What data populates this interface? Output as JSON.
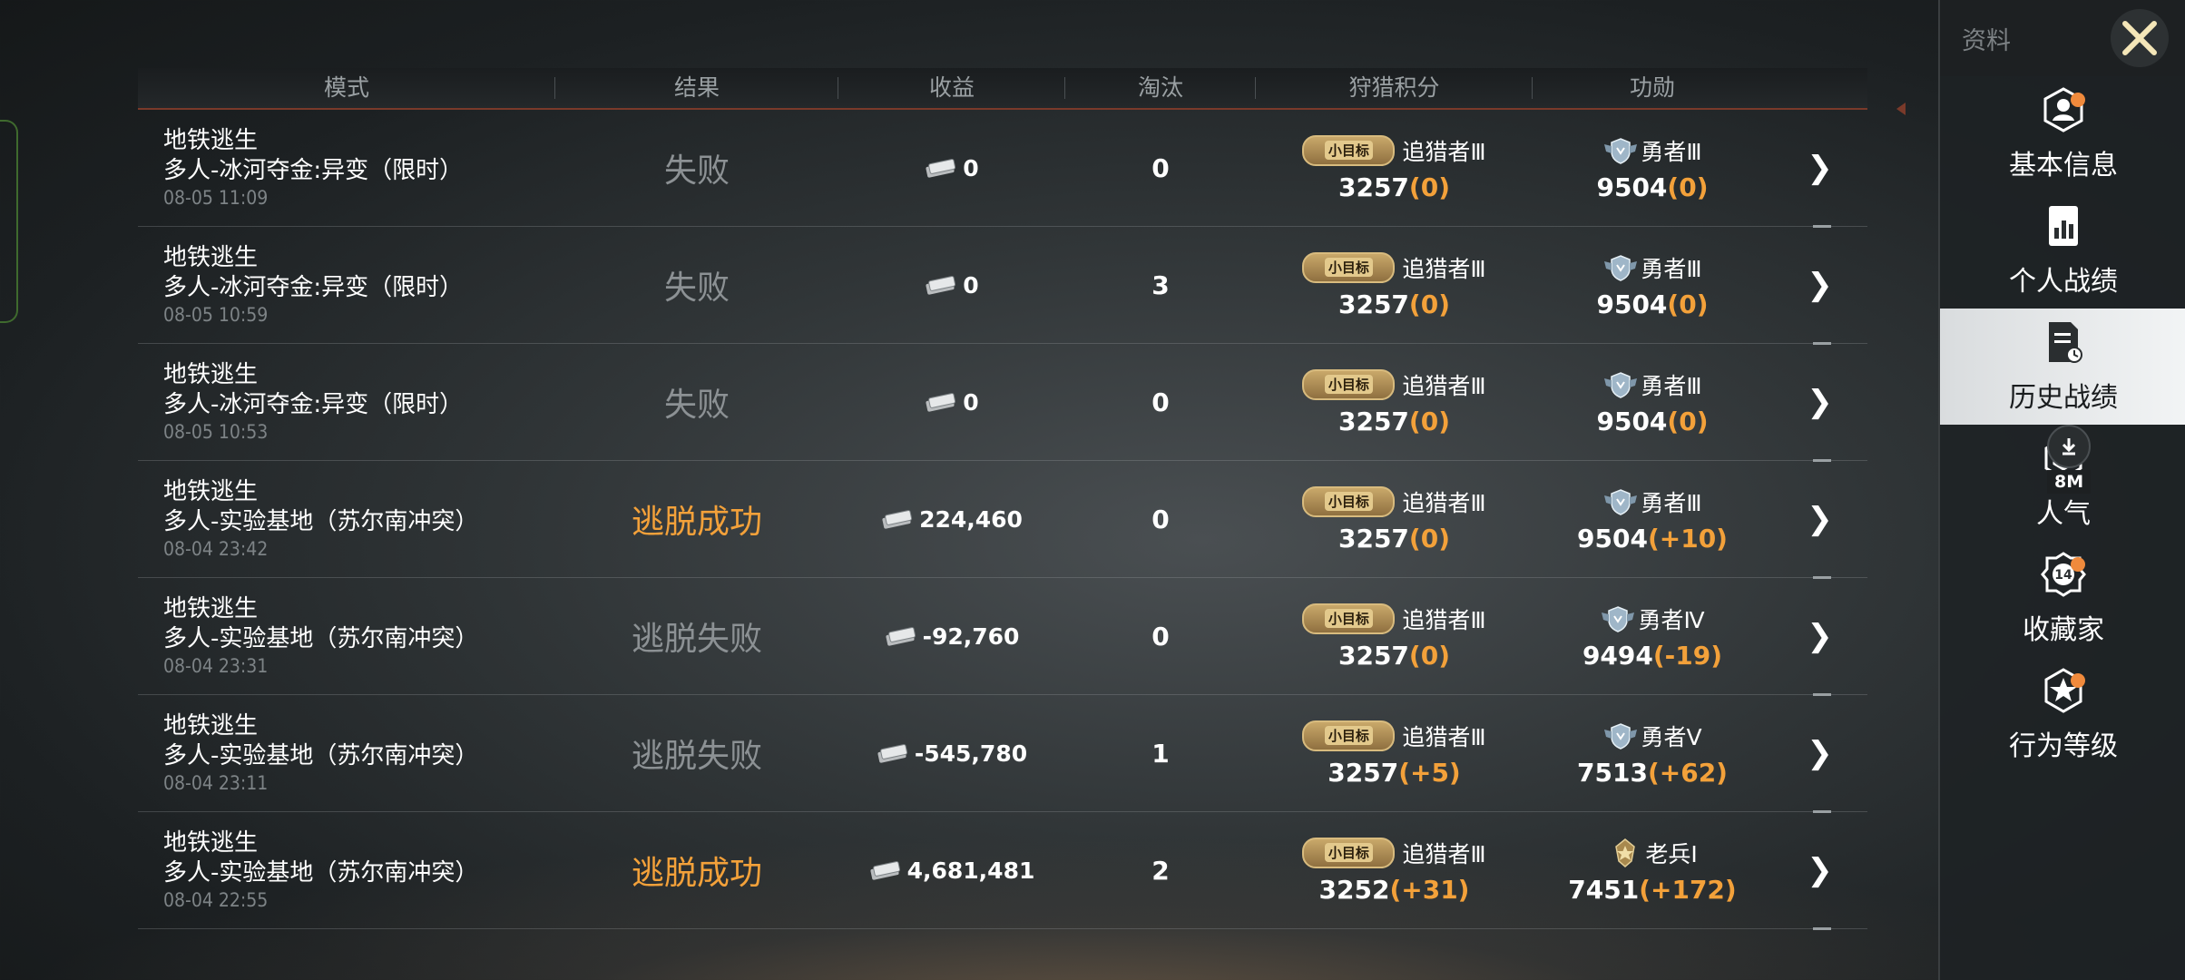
{
  "header": {
    "mode": "模式",
    "result": "结果",
    "gain": "收益",
    "kill": "淘汰",
    "hunt": "狩猎积分",
    "merit": "功勋"
  },
  "rows": [
    {
      "title": "地铁逃生",
      "sub": "多人-冰河夺金:异变（限时）",
      "time": "08-05 11:09",
      "result": "失败",
      "win": false,
      "gain": "0",
      "kill": "0",
      "badge": "小目标",
      "rank": "追猎者Ⅲ",
      "score": "3257",
      "score_delta": "(0)",
      "merit_rank": "勇者Ⅲ",
      "merit_score": "9504",
      "merit_delta": "(0)",
      "merit_icon": "wing-shield-icon"
    },
    {
      "title": "地铁逃生",
      "sub": "多人-冰河夺金:异变（限时）",
      "time": "08-05 10:59",
      "result": "失败",
      "win": false,
      "gain": "0",
      "kill": "3",
      "badge": "小目标",
      "rank": "追猎者Ⅲ",
      "score": "3257",
      "score_delta": "(0)",
      "merit_rank": "勇者Ⅲ",
      "merit_score": "9504",
      "merit_delta": "(0)",
      "merit_icon": "wing-shield-icon"
    },
    {
      "title": "地铁逃生",
      "sub": "多人-冰河夺金:异变（限时）",
      "time": "08-05 10:53",
      "result": "失败",
      "win": false,
      "gain": "0",
      "kill": "0",
      "badge": "小目标",
      "rank": "追猎者Ⅲ",
      "score": "3257",
      "score_delta": "(0)",
      "merit_rank": "勇者Ⅲ",
      "merit_score": "9504",
      "merit_delta": "(0)",
      "merit_icon": "wing-shield-icon"
    },
    {
      "title": "地铁逃生",
      "sub": "多人-实验基地（苏尔南冲突）",
      "time": "08-04 23:42",
      "result": "逃脱成功",
      "win": true,
      "gain": "224,460",
      "kill": "0",
      "badge": "小目标",
      "rank": "追猎者Ⅲ",
      "score": "3257",
      "score_delta": "(0)",
      "merit_rank": "勇者Ⅲ",
      "merit_score": "9504",
      "merit_delta": "(+10)",
      "merit_icon": "wing-shield-icon"
    },
    {
      "title": "地铁逃生",
      "sub": "多人-实验基地（苏尔南冲突）",
      "time": "08-04 23:31",
      "result": "逃脱失败",
      "win": false,
      "gain": "-92,760",
      "kill": "0",
      "badge": "小目标",
      "rank": "追猎者Ⅲ",
      "score": "3257",
      "score_delta": "(0)",
      "merit_rank": "勇者Ⅳ",
      "merit_score": "9494",
      "merit_delta": "(-19)",
      "merit_icon": "wing-shield-icon"
    },
    {
      "title": "地铁逃生",
      "sub": "多人-实验基地（苏尔南冲突）",
      "time": "08-04 23:11",
      "result": "逃脱失败",
      "win": false,
      "gain": "-545,780",
      "kill": "1",
      "badge": "小目标",
      "rank": "追猎者Ⅲ",
      "score": "3257",
      "score_delta": "(+5)",
      "merit_rank": "勇者Ⅴ",
      "merit_score": "7513",
      "merit_delta": "(+62)",
      "merit_icon": "wing-shield-icon"
    },
    {
      "title": "地铁逃生",
      "sub": "多人-实验基地（苏尔南冲突）",
      "time": "08-04 22:55",
      "result": "逃脱成功",
      "win": true,
      "gain": "4,681,481",
      "kill": "2",
      "badge": "小目标",
      "rank": "追猎者Ⅲ",
      "score": "3252",
      "score_delta": "(+31)",
      "merit_rank": "老兵Ⅰ",
      "merit_score": "7451",
      "merit_delta": "(+172)",
      "merit_icon": "gold-star-badge-icon"
    }
  ],
  "panel": {
    "title": "资料",
    "close_icon": "close-x-icon",
    "items": [
      {
        "label": "基本信息",
        "icon": "profile-icon",
        "active": false,
        "dot": true
      },
      {
        "label": "个人战绩",
        "icon": "chart-doc-icon",
        "active": false,
        "dot": false
      },
      {
        "label": "历史战绩",
        "icon": "history-doc-icon",
        "active": true,
        "dot": false
      },
      {
        "label": "人气",
        "icon": "popularity-icon",
        "active": false,
        "dot": false
      },
      {
        "label": "收藏家",
        "icon": "collector-badge-icon",
        "active": false,
        "dot": true,
        "badge_num": "14"
      },
      {
        "label": "行为等级",
        "icon": "behavior-star-icon",
        "active": false,
        "dot": true
      }
    ],
    "download": {
      "icon": "download-icon",
      "size": "8M"
    }
  },
  "colors": {
    "win": "#f3a13a",
    "dot": "#f08a3c",
    "header_line": "#7a3a2a"
  }
}
